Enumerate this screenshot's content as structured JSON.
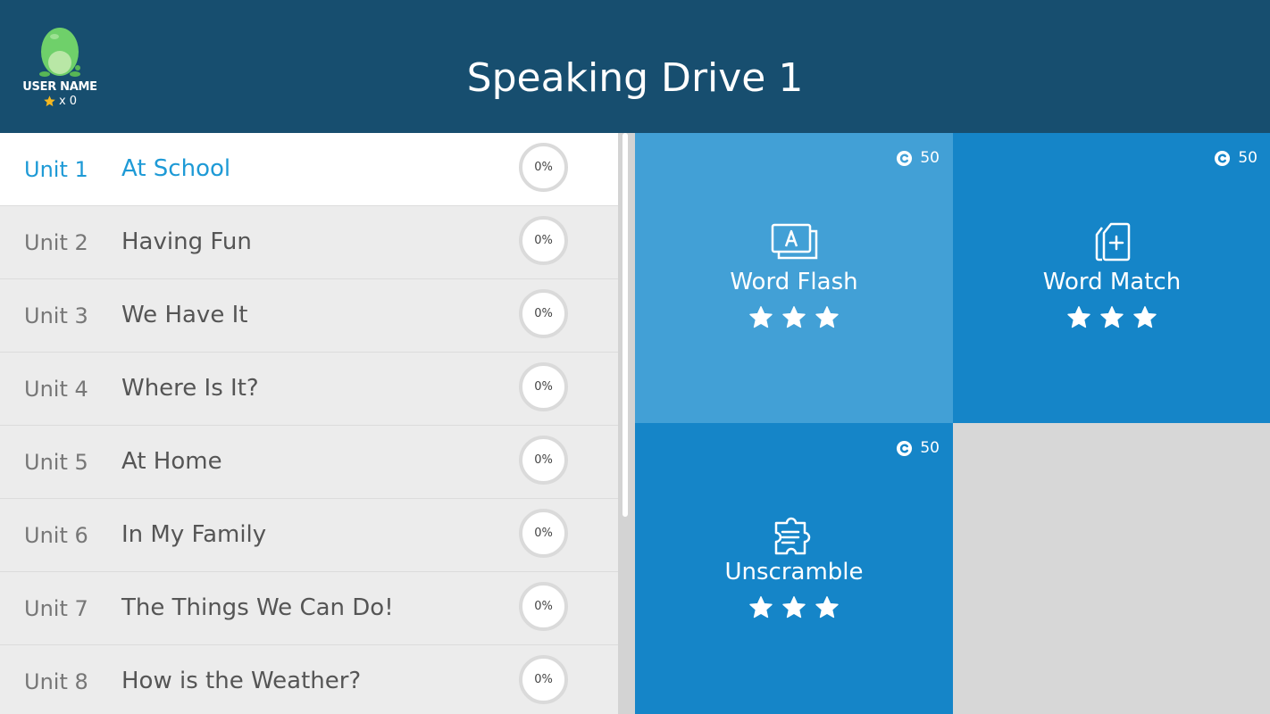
{
  "header": {
    "title": "Speaking Drive 1",
    "user_name": "USER NAME",
    "star_count": "x 0"
  },
  "units": [
    {
      "num": "Unit 1",
      "name": "At School",
      "progress": "0%",
      "active": true
    },
    {
      "num": "Unit 2",
      "name": "Having Fun",
      "progress": "0%"
    },
    {
      "num": "Unit 3",
      "name": "We Have It",
      "progress": "0%"
    },
    {
      "num": "Unit 4",
      "name": "Where Is It?",
      "progress": "0%"
    },
    {
      "num": "Unit 5",
      "name": "At Home",
      "progress": "0%"
    },
    {
      "num": "Unit 6",
      "name": "In My Family",
      "progress": "0%"
    },
    {
      "num": "Unit 7",
      "name": "The Things We Can Do!",
      "progress": "0%"
    },
    {
      "num": "Unit 8",
      "name": "How is the Weather?",
      "progress": "0%"
    }
  ],
  "activities": [
    {
      "label": "Word Flash",
      "coins": "50",
      "icon": "flashcard-icon",
      "stars": 3
    },
    {
      "label": "Word Match",
      "coins": "50",
      "icon": "card-plus-icon",
      "stars": 3
    },
    {
      "label": "Unscramble",
      "coins": "50",
      "icon": "puzzle-icon",
      "stars": 3
    }
  ],
  "colors": {
    "header": "#174e6f",
    "accent": "#1e9ad6",
    "tile_light": "#42a0d6",
    "tile_dark": "#1585c8",
    "star": "#f5b820"
  }
}
